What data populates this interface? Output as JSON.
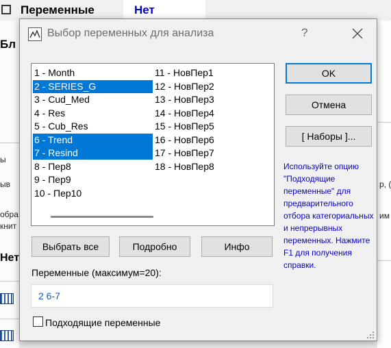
{
  "background": {
    "header_variables": "Переменные",
    "header_value": "Нет",
    "left_fragments": [
      "Бл",
      "Нет"
    ],
    "left_small_fragments": [
      "ы",
      "ыв",
      "обра",
      "книт"
    ],
    "right_fragments": [
      "р, (",
      "им"
    ]
  },
  "dialog": {
    "title": "Выбор переменных для анализа",
    "help_symbol": "?",
    "close_symbol": "×",
    "list_items": [
      {
        "label": "1 - Month",
        "selected": false
      },
      {
        "label": "2 - SERIES_G",
        "selected": true
      },
      {
        "label": "3 - Cud_Med",
        "selected": false
      },
      {
        "label": "4 - Res",
        "selected": false
      },
      {
        "label": "5 - Cub_Res",
        "selected": false
      },
      {
        "label": "6 - Trend",
        "selected": true
      },
      {
        "label": "7 - Resind",
        "selected": true
      },
      {
        "label": "8 - Пер8",
        "selected": false
      },
      {
        "label": "9 - Пер9",
        "selected": false
      },
      {
        "label": "10 - Пер10",
        "selected": false
      },
      {
        "label": "11 - НовПер1",
        "selected": false
      },
      {
        "label": "12 - НовПер2",
        "selected": false
      },
      {
        "label": "13 - НовПер3",
        "selected": false
      },
      {
        "label": "14 - НовПер4",
        "selected": false
      },
      {
        "label": "15 - НовПер5",
        "selected": false
      },
      {
        "label": "16 - НовПер6",
        "selected": false
      },
      {
        "label": "17 - НовПер7",
        "selected": false
      },
      {
        "label": "18 - НовПер8",
        "selected": false
      }
    ],
    "buttons": {
      "ok": "OK",
      "cancel": "Отмена",
      "sets": "[ Наборы ]...",
      "select_all": "Выбрать все",
      "details": "Подробно",
      "info": "Инфо"
    },
    "hint": "Используйте опцию \"Подходящие переменные\" для предварительного отбора категориальных и непрерывных переменных. Нажмите F1 для получения справки.",
    "variables_label": "Переменные (максимум=20):",
    "variables_value": "2 6-7",
    "checkbox_label": "Подходящие переменные",
    "checkbox_checked": false
  },
  "colors": {
    "selection": "#0078d7",
    "hint_text": "#0a00c8",
    "value_text": "#1a55c8",
    "header_value": "#0000cc"
  }
}
